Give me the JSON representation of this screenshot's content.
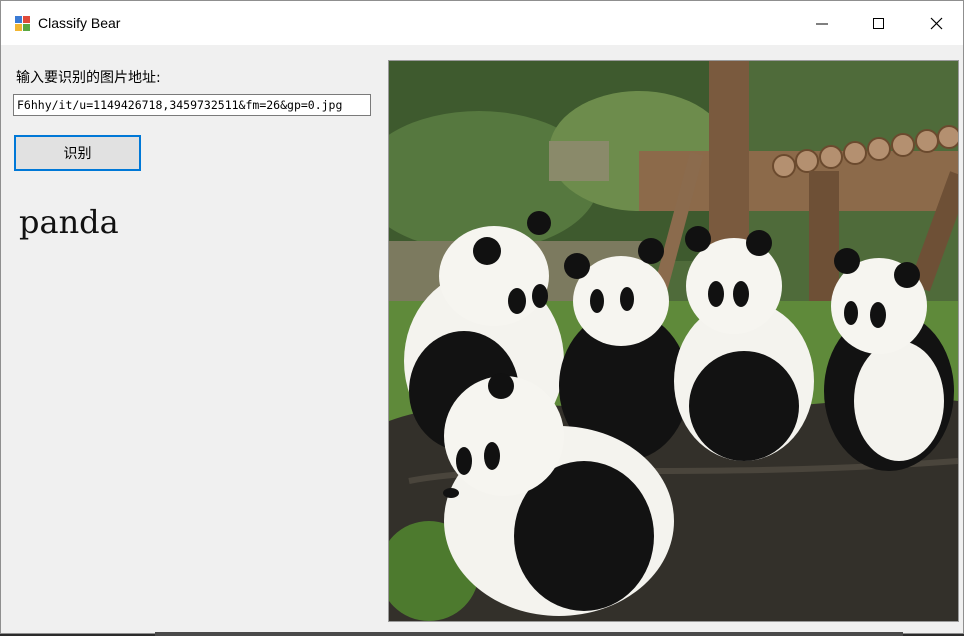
{
  "window": {
    "title": "Classify Bear",
    "controls": {
      "minimize_icon": "minimize-icon",
      "maximize_icon": "maximize-icon",
      "close_icon": "close-icon"
    }
  },
  "form": {
    "url_label": "输入要识别的图片地址:",
    "url_value": "F6hhy/it/u=1149426718,3459732511&fm=26&gp=0.jpg",
    "recognize_button": "识别",
    "result": "panda"
  },
  "colors": {
    "button_border": "#0078d7",
    "window_bg": "#f0f0f0"
  }
}
